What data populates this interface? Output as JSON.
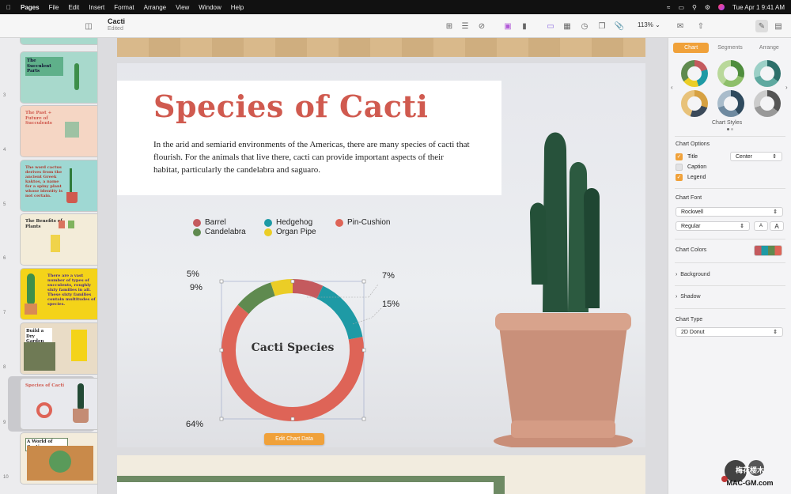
{
  "menubar": {
    "app": "Pages",
    "items": [
      "File",
      "Edit",
      "Insert",
      "Format",
      "Arrange",
      "View",
      "Window",
      "Help"
    ],
    "clock": "Tue Apr 1  9:41 AM"
  },
  "toolbar": {
    "doc_title": "Cacti",
    "doc_status": "Edited",
    "zoom": "113%"
  },
  "sidebar": {
    "thumbs": [
      {
        "num": "3",
        "title": "The Succulent Parts",
        "bg": "#a8d9cc"
      },
      {
        "num": "4",
        "title": "The Past + Future of Succulents",
        "bg": "#f5d6c4"
      },
      {
        "num": "5",
        "title": "The word cactus derives from the ancient Greek kaktos, a name for a spiny plant whose identity is not certain.",
        "bg": "#9fd8d3"
      },
      {
        "num": "6",
        "title": "The Benefits of Plants",
        "bg": "#f3ecd9"
      },
      {
        "num": "7",
        "title": "There are a vast number of types of succulents, roughly sixty families in all. These sixty families contain multitudes of species.",
        "bg": "#f4d319"
      },
      {
        "num": "8",
        "title": "Build a Dry Garden",
        "bg": "#e9dcc6"
      },
      {
        "num": "9",
        "title": "Species of Cacti",
        "bg": "#e8e9ed"
      },
      {
        "num": "10",
        "title": "A World of Cacti",
        "bg": "#f3ecdc"
      }
    ]
  },
  "slide": {
    "title": "Species of Cacti",
    "body": "In the arid and semiarid environments of the Americas, there are many species of cacti that flourish. For the animals that live there, cacti can provide important aspects of their habitat, particularly the candelabra and saguaro.",
    "edit_button": "Edit Chart Data"
  },
  "chart_data": {
    "type": "donut",
    "title": "Cacti Species",
    "series": [
      {
        "name": "Barrel",
        "value": 7,
        "color": "#c45a5e"
      },
      {
        "name": "Hedgehog",
        "value": 15,
        "color": "#1e9aa5"
      },
      {
        "name": "Pin-Cushion",
        "value": 64,
        "color": "#de6457"
      },
      {
        "name": "Candelabra",
        "value": 9,
        "color": "#5f8a4f"
      },
      {
        "name": "Organ Pipe",
        "value": 5,
        "color": "#ebcd26"
      }
    ],
    "labels": [
      "7%",
      "15%",
      "64%",
      "9%",
      "5%"
    ]
  },
  "inspector": {
    "tabs": [
      "Chart",
      "Segments",
      "Arrange"
    ],
    "chart_styles_label": "Chart Styles",
    "chart_options_label": "Chart Options",
    "title_label": "Title",
    "title_position": "Center",
    "caption_label": "Caption",
    "legend_label": "Legend",
    "chart_font_label": "Chart Font",
    "font_name": "Rockwell",
    "font_style": "Regular",
    "font_small": "A",
    "font_large": "A",
    "chart_colors_label": "Chart Colors",
    "background_label": "Background",
    "shadow_label": "Shadow",
    "chart_type_label": "Chart Type",
    "chart_type_value": "2D Donut"
  },
  "watermark": {
    "line1": "梅花楼木",
    "line2": "MAC-GM.com"
  }
}
